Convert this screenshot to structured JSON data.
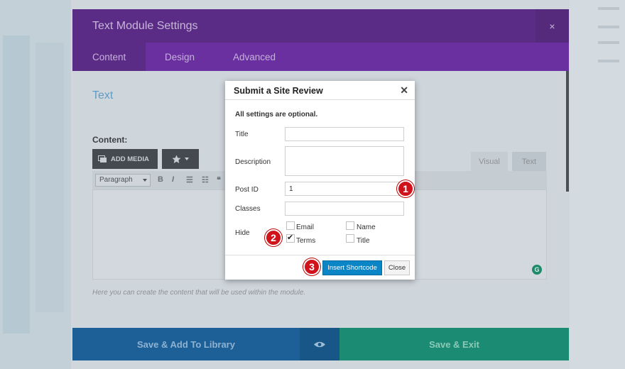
{
  "colors": {
    "accent": "#5b2c85",
    "tab_bar": "#6a30a0",
    "primary_button": "#0a85c5",
    "library": "#1d5f97",
    "exit": "#1b8b73",
    "marker": "#d0121b"
  },
  "panel": {
    "title": "Text Module Settings",
    "close_icon": "×",
    "tabs": [
      {
        "label": "Content"
      },
      {
        "label": "Design"
      },
      {
        "label": "Advanced"
      }
    ],
    "section_title": "Text",
    "content_label": "Content:",
    "add_media_label": "ADD MEDIA",
    "visual_tab": "Visual",
    "text_tab": "Text",
    "paragraph_select": "Paragraph",
    "help_text": "Here you can create the content that will be used within the module.",
    "save_library": "Save & Add To Library",
    "save_exit": "Save & Exit"
  },
  "dialog": {
    "title": "Submit a Site Review",
    "close_icon": "✕",
    "note": "All settings are optional.",
    "fields": {
      "title_label": "Title",
      "title_value": "",
      "description_label": "Description",
      "description_value": "",
      "post_id_label": "Post ID",
      "post_id_value": "1",
      "classes_label": "Classes",
      "classes_value": ""
    },
    "hide_label": "Hide",
    "hide_options": [
      {
        "label": "Email",
        "checked": false
      },
      {
        "label": "Name",
        "checked": false
      },
      {
        "label": "Terms",
        "checked": true
      },
      {
        "label": "Title",
        "checked": false
      }
    ],
    "insert_button": "Insert Shortcode",
    "close_button": "Close"
  },
  "markers": [
    "1",
    "2",
    "3"
  ]
}
